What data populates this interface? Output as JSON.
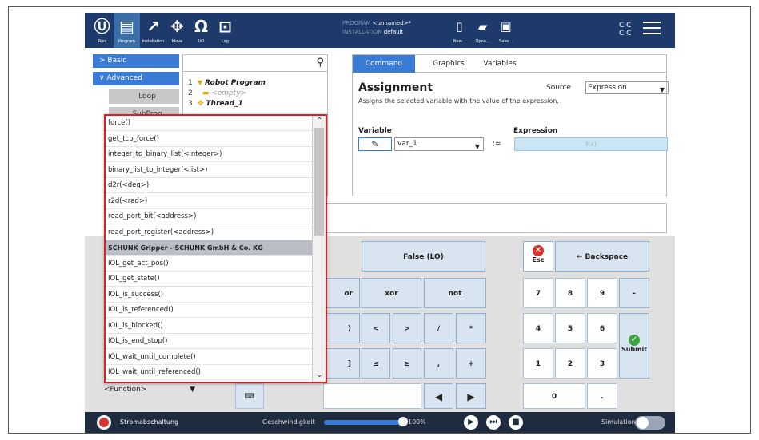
{
  "toolbar": {
    "items": [
      {
        "label": "Run",
        "icon": "ur-logo-icon"
      },
      {
        "label": "Program",
        "icon": "program-icon"
      },
      {
        "label": "Installation",
        "icon": "installation-icon"
      },
      {
        "label": "Move",
        "icon": "move-icon"
      },
      {
        "label": "I/O",
        "icon": "io-icon"
      },
      {
        "label": "Log",
        "icon": "log-icon"
      }
    ],
    "program_label": "PROGRAM",
    "program_value": "<unnamed>*",
    "installation_label": "INSTALLATION",
    "installation_value": "default",
    "new_label": "New...",
    "open_label": "Open...",
    "save_label": "Save...",
    "cc": "C C\nC C"
  },
  "sidebar": {
    "basic": "Basic",
    "advanced": "Advanced",
    "loop": "Loop",
    "subprog": "SubProg"
  },
  "tree": {
    "items": [
      {
        "num": "1",
        "text": "Robot Program"
      },
      {
        "num": "2",
        "text": "<empty>"
      },
      {
        "num": "3",
        "text": "Thread_1"
      }
    ]
  },
  "tabs": {
    "command": "Command",
    "graphics": "Graphics",
    "variables": "Variables"
  },
  "assignment": {
    "title": "Assignment",
    "description": "Assigns the selected variable with the value of the expression.",
    "source_label": "Source",
    "source_value": "Expression",
    "variable_label": "Variable",
    "variable_value": "var_1",
    "assign_symbol": ":=",
    "expression_label": "Expression",
    "expression_value": "f(x)"
  },
  "function_dropdown": {
    "items": [
      "force()",
      "get_tcp_force()",
      "integer_to_binary_list(<integer>)",
      "binary_list_to_integer(<list>)",
      "d2r(<deg>)",
      "r2d(<rad>)",
      "read_port_bit(<address>)",
      "read_port_register(<address>)",
      "SCHUNK Gripper - SCHUNK GmbH & Co. KG",
      "IOL_get_act_pos()",
      "IOL_get_state()",
      "IOL_is_success()",
      "IOL_is_referenced()",
      "IOL_is_blocked()",
      "IOL_is_end_stop()",
      "IOL_wait_until_complete()",
      "IOL_wait_until_referenced()"
    ],
    "highlighted_index": 8,
    "selected": "<Function>"
  },
  "keypad": {
    "false_lo": "False (LO)",
    "or": "or",
    "xor": "xor",
    "not": "not",
    "rparen": ")",
    "lt": "<",
    "gt": ">",
    "slash": "/",
    "star": "*",
    "rbracket": "]",
    "le": "≤",
    "ge": "≥",
    "comma": ",",
    "plus": "+",
    "esc": "Esc",
    "backspace": "← Backspace",
    "n7": "7",
    "n8": "8",
    "n9": "9",
    "minus": "-",
    "n4": "4",
    "n5": "5",
    "n6": "6",
    "n1": "1",
    "n2": "2",
    "n3": "3",
    "n0": "0",
    "dot": ".",
    "submit": "Submit"
  },
  "status": {
    "stop_label": "Stromabschaltung",
    "speed_label": "Geschwindigkeit",
    "speed_value": "100%",
    "speed_fraction": 1.0,
    "simulation_label": "Simulation"
  }
}
